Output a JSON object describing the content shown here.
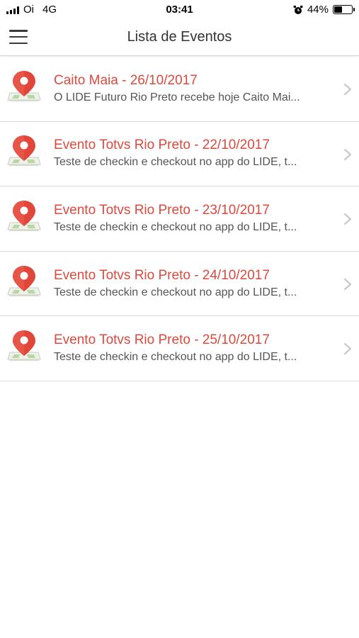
{
  "status_bar": {
    "carrier": "Oi",
    "network": "4G",
    "time": "03:41",
    "battery_percent": "44%",
    "battery_level": 0.44,
    "alarm_icon": "alarm-clock-icon"
  },
  "header": {
    "title": "Lista de Eventos",
    "menu_icon": "hamburger-menu-icon"
  },
  "colors": {
    "accent": "#dc4a3e",
    "pin_red": "#e0463a",
    "map_green": "#b9d7a3"
  },
  "events": [
    {
      "title": "Caito Maia - 26/10/2017",
      "description": "O LIDE Futuro Rio Preto recebe hoje Caito Mai..."
    },
    {
      "title": "Evento Totvs Rio Preto - 22/10/2017",
      "description": "Teste de checkin e checkout no app do LIDE, t..."
    },
    {
      "title": "Evento Totvs Rio Preto - 23/10/2017",
      "description": "Teste de checkin e checkout no app do LIDE, t..."
    },
    {
      "title": "Evento Totvs Rio Preto - 24/10/2017",
      "description": "Teste de checkin e checkout no app do LIDE, t..."
    },
    {
      "title": "Evento Totvs Rio Preto - 25/10/2017",
      "description": "Teste de checkin e checkout no app do LIDE, t..."
    }
  ]
}
